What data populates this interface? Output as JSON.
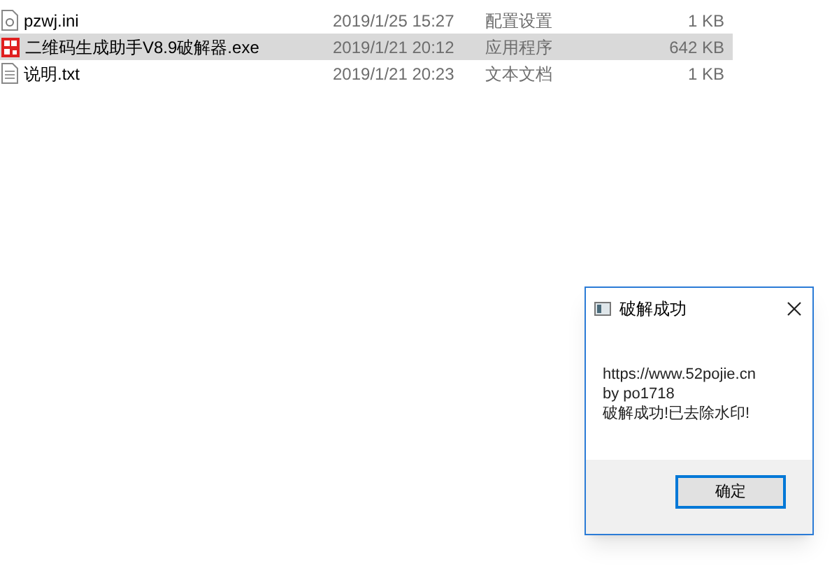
{
  "files": [
    {
      "name": "pzwj.ini",
      "kind": "settings",
      "date": "2019/1/25 15:27",
      "type": "配置设置",
      "size": "1 KB",
      "selected": false
    },
    {
      "name": "二维码生成助手V8.9破解器.exe",
      "kind": "app",
      "date": "2019/1/21 20:12",
      "type": "应用程序",
      "size": "642 KB",
      "selected": true
    },
    {
      "name": "说明.txt",
      "kind": "text",
      "date": "2019/1/21 20:23",
      "type": "文本文档",
      "size": "1 KB",
      "selected": false
    }
  ],
  "dialog": {
    "title": "破解成功",
    "lines": [
      "https://www.52pojie.cn",
      "by po1718",
      "破解成功!已去除水印!"
    ],
    "button": "确定"
  }
}
